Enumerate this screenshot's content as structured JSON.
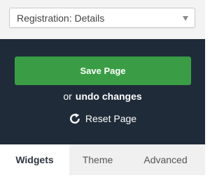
{
  "page_selector": {
    "selected": "Registration: Details"
  },
  "actions": {
    "save_label": "Save Page",
    "or_text": "or",
    "undo_label": "undo changes",
    "reset_label": "Reset Page"
  },
  "tabs": [
    {
      "label": "Widgets",
      "active": true
    },
    {
      "label": "Theme",
      "active": false
    },
    {
      "label": "Advanced",
      "active": false
    }
  ],
  "colors": {
    "panel_background": "#1f2b39",
    "save_button": "#3a9d45",
    "tab_bar": "#f0f0f0"
  },
  "icons": {
    "select": "chevron-down-icon",
    "reset": "refresh-icon"
  }
}
